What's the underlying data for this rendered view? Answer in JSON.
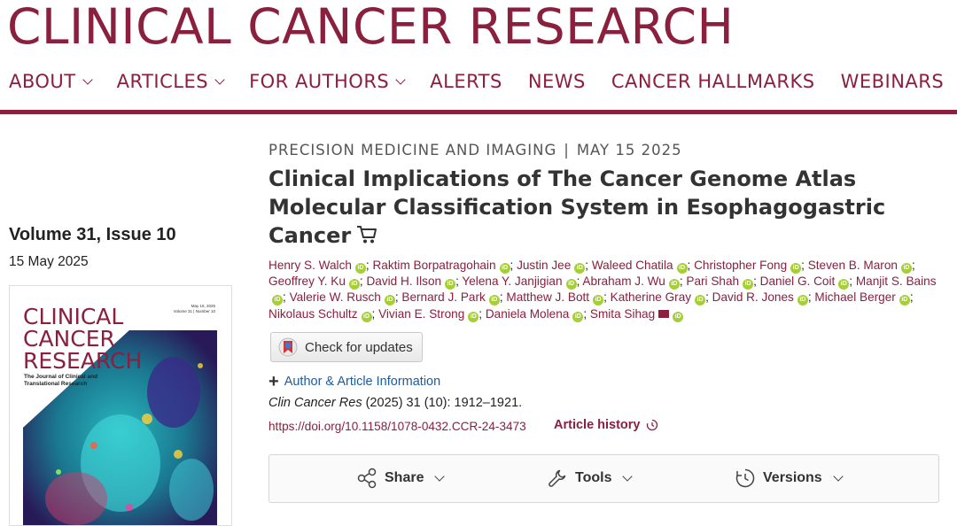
{
  "brand": "CLINICAL CANCER RESEARCH",
  "nav": {
    "about": "ABOUT",
    "articles": "ARTICLES",
    "for_authors": "FOR AUTHORS",
    "alerts": "ALERTS",
    "news": "NEWS",
    "hallmarks": "CANCER HALLMARKS",
    "webinars": "WEBINARS"
  },
  "issue": {
    "volume": "Volume 31, Issue 10",
    "date": "15 May 2025"
  },
  "cover": {
    "title_line1": "CLINICAL",
    "title_line2": "CANCER",
    "title_line3": "RESEARCH",
    "subtitle": "The Journal of Clinical and Translational Research",
    "meta_date": "May 15, 2025",
    "meta_volume": "Volume 31 | Number 10"
  },
  "article": {
    "section": "PRECISION MEDICINE AND IMAGING",
    "separator": "|",
    "date": "MAY 15 2025",
    "title": "Clinical Implications of The Cancer Genome Atlas Molecular Classification System in Esophagogastric Cancer",
    "authors": [
      "Henry S. Walch",
      "Raktim Borpatragohain",
      "Justin Jee",
      "Waleed Chatila",
      "Christopher Fong",
      "Steven B. Maron",
      "Geoffrey Y. Ku",
      "David H. Ilson",
      "Yelena Y. Janjigian",
      "Abraham J. Wu",
      "Pari Shah",
      "Daniel G. Coit",
      "Manjit S. Bains",
      "Valerie W. Rusch",
      "Bernard J. Park",
      "Matthew J. Bott",
      "Katherine Gray",
      "David R. Jones",
      "Michael Berger",
      "Nikolaus Schultz",
      "Vivian E. Strong",
      "Daniela Molena",
      "Smita Sihag"
    ],
    "orcid_label": "iD",
    "check_updates": "Check for updates",
    "author_info": "Author & Article Information",
    "citation_journal": "Clin Cancer Res",
    "citation_rest": " (2025) 31 (10): 1912–1921.",
    "doi": "https://doi.org/10.1158/1078-0432.CCR-24-3473",
    "history": "Article history"
  },
  "toolbar": {
    "share": "Share",
    "tools": "Tools",
    "versions": "Versions"
  },
  "colors": {
    "brand": "#8a1f3e",
    "orcid": "#a6ce39",
    "link": "#1a5c9e"
  }
}
